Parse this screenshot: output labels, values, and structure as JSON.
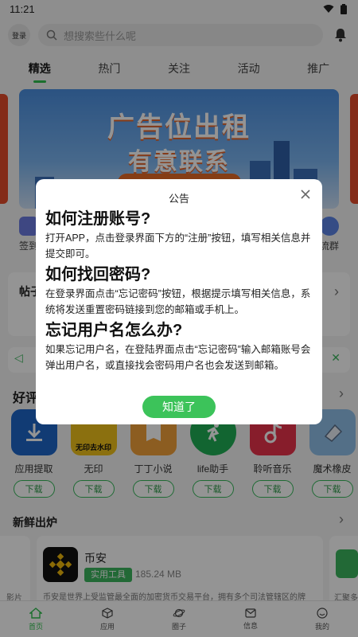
{
  "status": {
    "time": "11:21"
  },
  "header": {
    "login_label": "登录",
    "search_placeholder": "想搜索些什么呢"
  },
  "tabs": [
    {
      "label": "精选",
      "active": true
    },
    {
      "label": "热门"
    },
    {
      "label": "关注"
    },
    {
      "label": "活动"
    },
    {
      "label": "推广"
    }
  ],
  "banner": {
    "line1": "广告位出租",
    "line2": "有意联系"
  },
  "quick": {
    "left_label": "签到",
    "right_label": "流群"
  },
  "sections": {
    "posts_title": "帖子",
    "good_title": "好评",
    "fresh_title": "新鲜出炉"
  },
  "apps": [
    {
      "name": "应用提取",
      "button": "下载",
      "color": "#1e66c9",
      "icon_name": "download-arrow-icon"
    },
    {
      "name": "无印",
      "button": "下载",
      "color": "#f0c11a",
      "icon_text": "无印去水印"
    },
    {
      "name": "丁丁小说",
      "button": "下载",
      "color": "#f2a13a",
      "icon_name": "book-icon"
    },
    {
      "name": "life助手",
      "button": "下载",
      "color": "#1faf55",
      "icon_name": "runner-icon"
    },
    {
      "name": "聆听音乐",
      "button": "下载",
      "color": "#e8334a",
      "icon_name": "music-note-icon"
    },
    {
      "name": "魔术橡皮",
      "button": "下载",
      "color": "#8fc0e8",
      "icon_name": "eraser-icon"
    }
  ],
  "fresh_app": {
    "name": "币安",
    "tag": "实用工具",
    "size": "185.24 MB",
    "desc": "币安是世界上受监管最全面的加密货币交易平台，拥有多个司法管辖区的牌"
  },
  "fresh_side": {
    "left_label": "影片",
    "right_label": "汇聚多"
  },
  "bottom_nav": [
    {
      "label": "首页",
      "active": true,
      "icon_name": "home-icon"
    },
    {
      "label": "应用",
      "icon_name": "cube-icon"
    },
    {
      "label": "圈子",
      "icon_name": "planet-icon"
    },
    {
      "label": "信息",
      "icon_name": "message-icon"
    },
    {
      "label": "我的",
      "icon_name": "smile-icon"
    }
  ],
  "modal": {
    "title": "公告",
    "q1_title": "如何注册账号?",
    "q1_text": "打开APP，点击登录界面下方的“注册”按钮，填写相关信息并提交即可。",
    "q2_title": "如何找回密码?",
    "q2_text": "在登录界面点击“忘记密码”按钮，根据提示填写相关信息，系统将发送重置密码链接到您的邮箱或手机上。",
    "q3_title": "忘记用户名怎么办?",
    "q3_text": "如果忘记用户名，在登陆界面点击“忘记密码”输入邮箱账号会弹出用户名，或直接找会密码用户名也会发送到邮箱。",
    "confirm_label": "知道了"
  },
  "colors": {
    "accent": "#2fbf4f",
    "overlay": "#000000"
  }
}
